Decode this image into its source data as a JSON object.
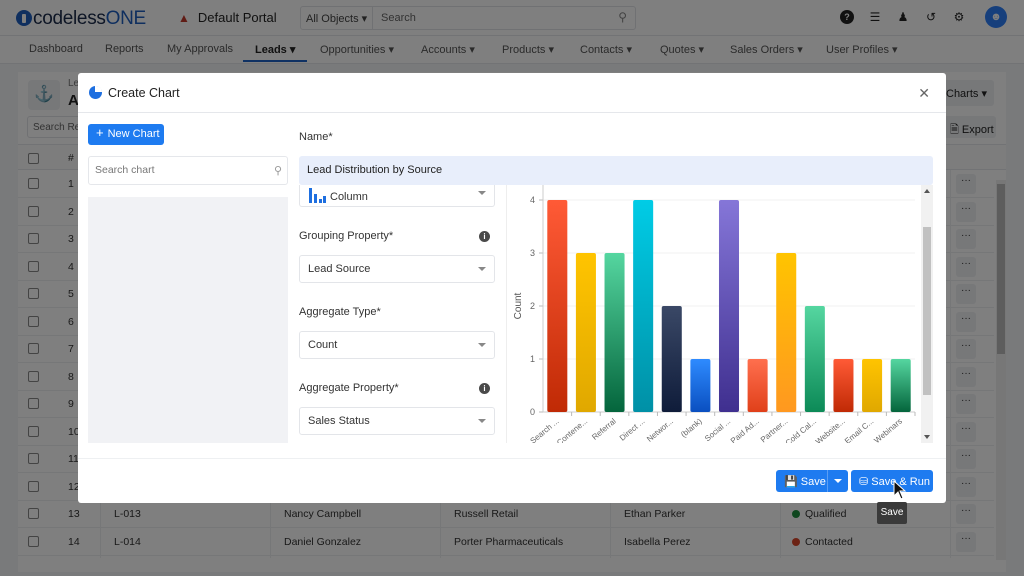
{
  "app": {
    "logo_main": "codeless",
    "logo_accent": "ONE",
    "portal": "Default Portal",
    "search": {
      "scope": "All Objects",
      "placeholder": "Search"
    },
    "top_icons": [
      "help-icon",
      "database-icon",
      "add-user-icon",
      "history-icon",
      "settings-icon",
      "user-avatar-icon"
    ]
  },
  "nav": {
    "items": [
      {
        "label": "Dashboard",
        "dropdown": false
      },
      {
        "label": "Reports",
        "dropdown": false
      },
      {
        "label": "My Approvals",
        "dropdown": false
      },
      {
        "label": "Leads",
        "dropdown": true,
        "active": true
      },
      {
        "label": "Opportunities",
        "dropdown": true
      },
      {
        "label": "Accounts",
        "dropdown": true
      },
      {
        "label": "Products",
        "dropdown": true
      },
      {
        "label": "Contacts",
        "dropdown": true
      },
      {
        "label": "Quotes",
        "dropdown": true
      },
      {
        "label": "Sales Orders",
        "dropdown": true
      },
      {
        "label": "User Profiles",
        "dropdown": true
      }
    ]
  },
  "background_page": {
    "title_small": "Le",
    "title_big": "A",
    "search_placeholder": "Search Re",
    "charts_button": "Charts",
    "export_button": "Export",
    "header_hash": "#",
    "rows": [
      {
        "num": "1"
      },
      {
        "num": "2"
      },
      {
        "num": "3"
      },
      {
        "num": "4"
      },
      {
        "num": "5"
      },
      {
        "num": "6"
      },
      {
        "num": "7"
      },
      {
        "num": "8"
      },
      {
        "num": "9"
      },
      {
        "num": "10"
      },
      {
        "num": "11"
      },
      {
        "num": "12"
      },
      {
        "num": "13",
        "id": "L-013",
        "name": "Nancy Campbell",
        "company": "Russell Retail",
        "owner": "Ethan Parker",
        "status": "Qualified",
        "status_color": "#1e8e3e"
      },
      {
        "num": "14",
        "id": "L-014",
        "name": "Daniel Gonzalez",
        "company": "Porter Pharmaceuticals",
        "owner": "Isabella Perez",
        "status": "Contacted",
        "status_color": "#d9472b"
      }
    ],
    "more_label": "···"
  },
  "modal": {
    "title": "Create Chart",
    "new_chart_button": "New Chart",
    "search_placeholder": "Search chart",
    "name_label": "Name*",
    "name_value": "Lead Distribution by Source",
    "chart_type": "Column",
    "grouping_label": "Grouping Property*",
    "grouping_value": "Lead Source",
    "aggregate_type_label": "Aggregate Type*",
    "aggregate_type_value": "Count",
    "aggregate_property_label": "Aggregate Property*",
    "aggregate_property_value": "Sales Status",
    "save_button": "Save",
    "save_run_button": "Save & Run",
    "tooltip": "Save"
  },
  "chart_data": {
    "type": "bar",
    "title": "",
    "xlabel": "",
    "ylabel": "Count",
    "ylim": [
      0,
      4
    ],
    "yticks": [
      0,
      1,
      2,
      3,
      4
    ],
    "grid": true,
    "categories": [
      "Search ...",
      "Contene...",
      "Referral",
      "Direct ...",
      "Networ...",
      "(blank)",
      "Social ...",
      "Paid Ad...",
      "Partner...",
      "Cold Cal...",
      "Website...",
      "Email C...",
      "Webinars"
    ],
    "values": [
      4,
      3,
      3,
      4,
      2,
      1,
      4,
      1,
      3,
      2,
      1,
      1,
      1
    ],
    "colors": [
      [
        "#ff5a36",
        "#c02a05"
      ],
      [
        "#ffc400",
        "#e0a800"
      ],
      [
        "#55d6a0",
        "#04653c"
      ],
      [
        "#00cce6",
        "#0090a6"
      ],
      [
        "#3a4866",
        "#0f1c3a"
      ],
      [
        "#2e8bff",
        "#0a4fc0"
      ],
      [
        "#8576d8",
        "#3f2f8f"
      ],
      [
        "#ff6f4e",
        "#e0401a"
      ],
      [
        "#ffc400",
        "#ff9820"
      ],
      [
        "#55d6a0",
        "#0c8a57"
      ],
      [
        "#ff5a36",
        "#c02a05"
      ],
      [
        "#ffc400",
        "#e0a800"
      ],
      [
        "#55d6a0",
        "#04653c"
      ]
    ]
  }
}
